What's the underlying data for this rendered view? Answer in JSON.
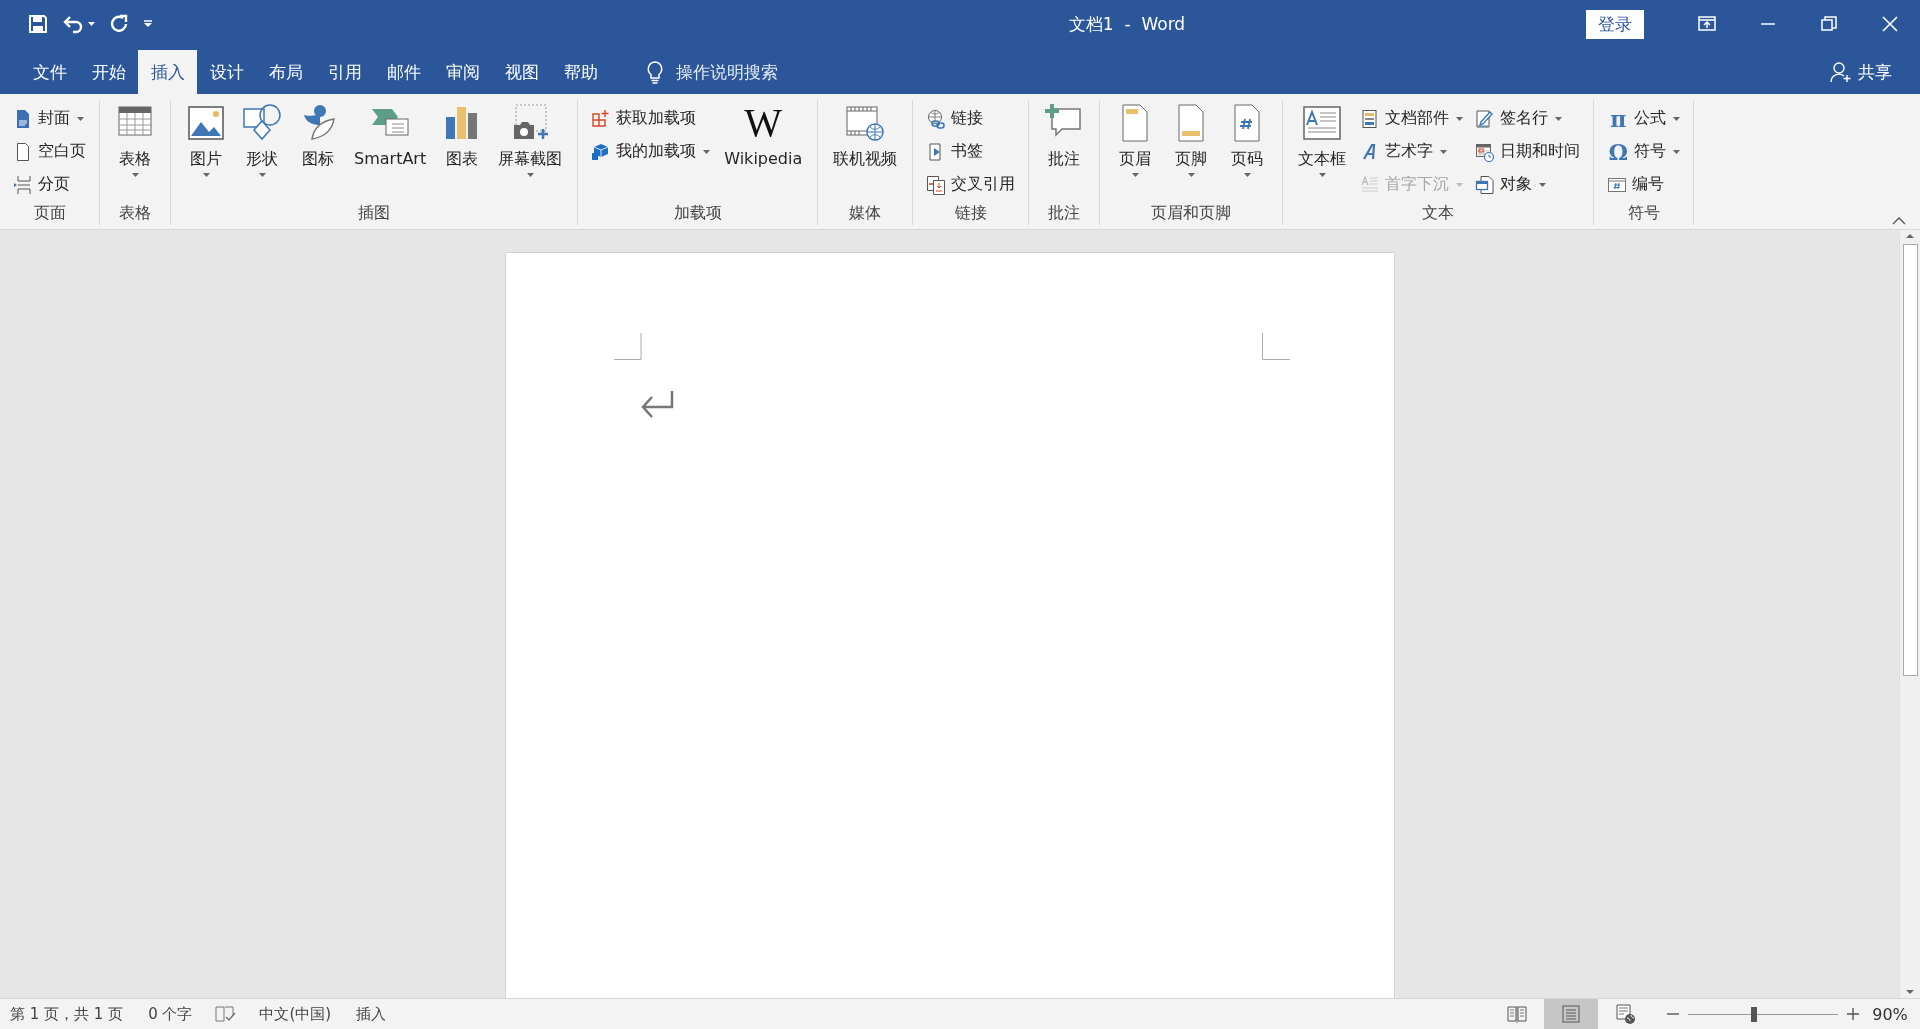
{
  "window": {
    "title": "文档1  -  Word",
    "sign_in": "登录"
  },
  "tabs": [
    {
      "label": "文件",
      "selected": false
    },
    {
      "label": "开始",
      "selected": false
    },
    {
      "label": "插入",
      "selected": true
    },
    {
      "label": "设计",
      "selected": false
    },
    {
      "label": "布局",
      "selected": false
    },
    {
      "label": "引用",
      "selected": false
    },
    {
      "label": "邮件",
      "selected": false
    },
    {
      "label": "审阅",
      "selected": false
    },
    {
      "label": "视图",
      "selected": false
    },
    {
      "label": "帮助",
      "selected": false
    }
  ],
  "tell_me": {
    "placeholder": "操作说明搜索"
  },
  "share": "共享",
  "ribbon": {
    "groups": [
      {
        "label": "页面",
        "columns": [
          {
            "kind": "stack",
            "items": [
              {
                "label": "封面",
                "dropdown": true,
                "disabled": false
              },
              {
                "label": "空白页",
                "dropdown": false,
                "disabled": false
              },
              {
                "label": "分页",
                "dropdown": false,
                "disabled": false
              }
            ]
          }
        ]
      },
      {
        "label": "表格",
        "columns": [
          {
            "kind": "large",
            "label": "表格",
            "dropdown": true,
            "disabled": false
          }
        ]
      },
      {
        "label": "插图",
        "columns": [
          {
            "kind": "large",
            "label": "图片",
            "dropdown": true,
            "disabled": false
          },
          {
            "kind": "large",
            "label": "形状",
            "dropdown": true,
            "disabled": false
          },
          {
            "kind": "large",
            "label": "图标",
            "dropdown": false,
            "disabled": false
          },
          {
            "kind": "large",
            "label": "SmartArt",
            "dropdown": false,
            "disabled": false
          },
          {
            "kind": "large",
            "label": "图表",
            "dropdown": false,
            "disabled": false
          },
          {
            "kind": "large",
            "label": "屏幕截图",
            "dropdown": true,
            "disabled": false
          }
        ]
      },
      {
        "label": "加载项",
        "columns": [
          {
            "kind": "stack",
            "items": [
              {
                "label": "获取加载项",
                "dropdown": false,
                "disabled": false
              },
              {
                "label": "我的加载项",
                "dropdown": true,
                "disabled": false
              }
            ]
          },
          {
            "kind": "large",
            "label": "Wikipedia",
            "glyph": "W",
            "dropdown": false,
            "disabled": false
          }
        ]
      },
      {
        "label": "媒体",
        "columns": [
          {
            "kind": "large",
            "label": "联机视频",
            "dropdown": false,
            "disabled": false
          }
        ]
      },
      {
        "label": "链接",
        "columns": [
          {
            "kind": "stack",
            "items": [
              {
                "label": "链接",
                "dropdown": false,
                "disabled": false
              },
              {
                "label": "书签",
                "dropdown": false,
                "disabled": false
              },
              {
                "label": "交叉引用",
                "dropdown": false,
                "disabled": false
              }
            ]
          }
        ]
      },
      {
        "label": "批注",
        "columns": [
          {
            "kind": "large",
            "label": "批注",
            "dropdown": false,
            "disabled": false
          }
        ]
      },
      {
        "label": "页眉和页脚",
        "columns": [
          {
            "kind": "large",
            "label": "页眉",
            "dropdown": true,
            "disabled": false
          },
          {
            "kind": "large",
            "label": "页脚",
            "dropdown": true,
            "disabled": false
          },
          {
            "kind": "large",
            "label": "页码",
            "dropdown": true,
            "disabled": false
          }
        ]
      },
      {
        "label": "文本",
        "columns": [
          {
            "kind": "large",
            "label": "文本框",
            "dropdown": true,
            "disabled": false
          },
          {
            "kind": "stack",
            "items": [
              {
                "label": "文档部件",
                "dropdown": true,
                "disabled": false
              },
              {
                "label": "艺术字",
                "dropdown": true,
                "disabled": false
              },
              {
                "label": "首字下沉",
                "dropdown": true,
                "disabled": true
              }
            ]
          },
          {
            "kind": "stack",
            "items": [
              {
                "label": "签名行",
                "dropdown": true,
                "disabled": false
              },
              {
                "label": "日期和时间",
                "dropdown": false,
                "disabled": false
              },
              {
                "label": "对象",
                "dropdown": true,
                "disabled": false
              }
            ]
          }
        ]
      },
      {
        "label": "符号",
        "columns": [
          {
            "kind": "stack",
            "items": [
              {
                "label": "公式",
                "glyph": "π",
                "dropdown": true,
                "disabled": false
              },
              {
                "label": "符号",
                "glyph": "Ω",
                "dropdown": true,
                "disabled": false
              },
              {
                "label": "编号",
                "dropdown": false,
                "disabled": false
              }
            ]
          }
        ]
      }
    ]
  },
  "status_bar": {
    "page": "第 1 页，共 1 页",
    "words": "0 个字",
    "language": "中文(中国)",
    "mode": "插入",
    "views": [
      {
        "kind": "read",
        "selected": false
      },
      {
        "kind": "print",
        "selected": true
      },
      {
        "kind": "web",
        "selected": false
      }
    ],
    "zoom": {
      "level": 0.44,
      "reading": "90%"
    }
  }
}
